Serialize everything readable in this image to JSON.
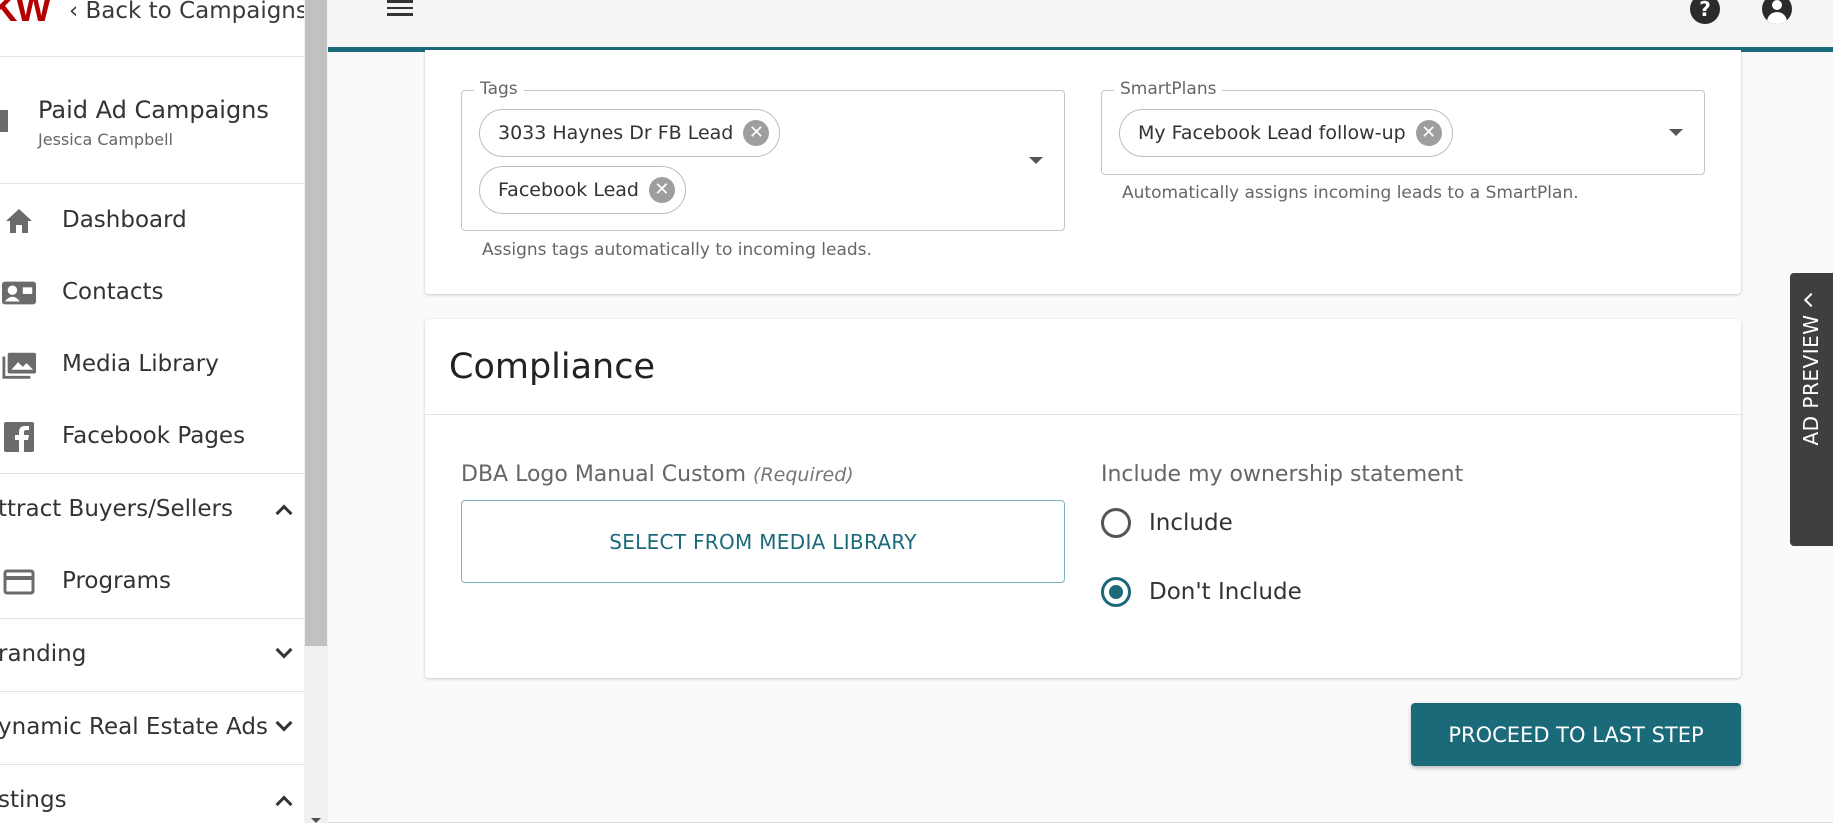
{
  "sidebar": {
    "logo": "KW",
    "back_link": "Back to Campaigns",
    "campaign_title": "Paid Ad Campaigns",
    "campaign_owner": "Jessica Campbell",
    "nav": [
      {
        "label": "Dashboard",
        "icon": "home-icon"
      },
      {
        "label": "Contacts",
        "icon": "contact-card-icon"
      },
      {
        "label": "Media Library",
        "icon": "photo-library-icon"
      },
      {
        "label": "Facebook Pages",
        "icon": "facebook-icon"
      }
    ],
    "sections": [
      {
        "label": "ttract Buyers/Sellers",
        "state": "expanded"
      },
      {
        "label": "randing",
        "state": "collapsed"
      },
      {
        "label": "ynamic Real Estate Ads",
        "state": "collapsed"
      },
      {
        "label": "stings",
        "state": "expanded"
      }
    ],
    "programs_label": "Programs"
  },
  "header": {
    "help_icon": "?"
  },
  "tags_field": {
    "legend": "Tags",
    "chips": [
      "3033 Haynes Dr FB Lead",
      "Facebook Lead"
    ],
    "helper": "Assigns tags automatically to incoming leads."
  },
  "smartplans_field": {
    "legend": "SmartPlans",
    "chips": [
      "My Facebook Lead follow-up"
    ],
    "helper": "Automatically assigns incoming leads to a SmartPlan."
  },
  "compliance": {
    "title": "Compliance",
    "dba_label": "DBA Logo Manual Custom",
    "dba_required": "(Required)",
    "media_button": "SELECT FROM MEDIA LIBRARY",
    "ownership_label": "Include my ownership statement",
    "options": [
      {
        "label": "Include",
        "selected": false
      },
      {
        "label": "Don't Include",
        "selected": true
      }
    ]
  },
  "proceed_button": "PROCEED TO LAST STEP",
  "ad_preview_label": "AD PREVIEW",
  "colors": {
    "accent": "#1a6a7a",
    "brand_red": "#b40101"
  }
}
